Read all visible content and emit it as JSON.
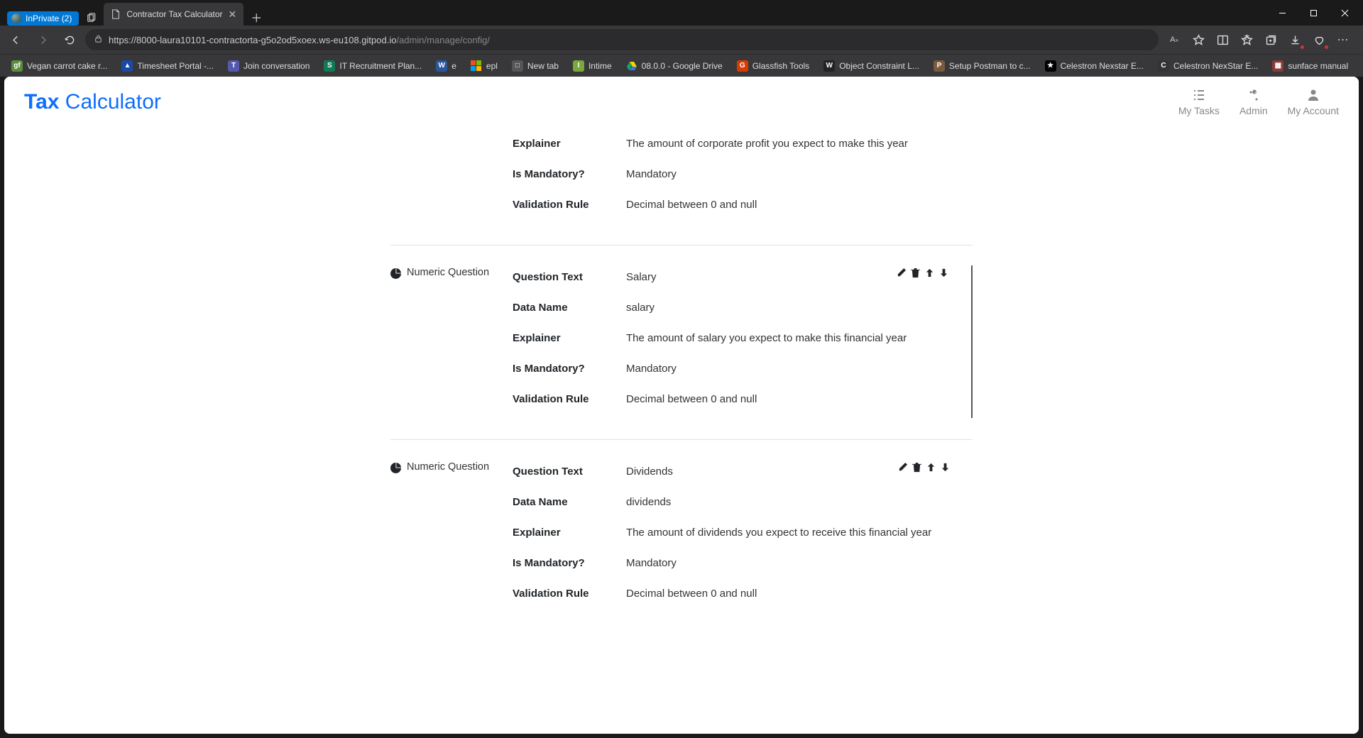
{
  "browser": {
    "inprivate_label": "InPrivate (2)",
    "tab_title": "Contractor Tax Calculator",
    "url_host": "https://8000-laura10101-contractorta-g5o2od5xoex.ws-eu108.gitpod.io",
    "url_path": "/admin/manage/config/",
    "bookmarks": [
      {
        "label": "Vegan carrot cake r...",
        "color": "#5a8f3c",
        "glyph": "gf"
      },
      {
        "label": "Timesheet Portal -...",
        "color": "#1a4aa8",
        "glyph": "▲"
      },
      {
        "label": "Join conversation",
        "color": "#5558af",
        "glyph": "T"
      },
      {
        "label": "IT Recruitment Plan...",
        "color": "#0f7a54",
        "glyph": "S"
      },
      {
        "label": "e",
        "color": "#2b579a",
        "glyph": "W"
      },
      {
        "label": "epl",
        "color": "",
        "glyph": "⊞",
        "ms": true
      },
      {
        "label": "New tab",
        "color": "#555",
        "glyph": "□"
      },
      {
        "label": "Intime",
        "color": "#7aa83a",
        "glyph": "I"
      },
      {
        "label": "08.0.0 - Google Drive",
        "color": "",
        "glyph": "▲",
        "drive": true
      },
      {
        "label": "Glassfish Tools",
        "color": "#d83b01",
        "glyph": "G"
      },
      {
        "label": "Object Constraint L...",
        "color": "#222",
        "glyph": "W"
      },
      {
        "label": "Setup Postman to c...",
        "color": "#7a5a3a",
        "glyph": "P"
      },
      {
        "label": "Celestron Nexstar E...",
        "color": "#000",
        "glyph": "★"
      },
      {
        "label": "Celestron NexStar E...",
        "color": "#333",
        "glyph": "C"
      },
      {
        "label": "sunface manual",
        "color": "#8a3a3a",
        "glyph": "▦"
      }
    ]
  },
  "app": {
    "brand_bold": "Tax",
    "brand_light": " Calculator",
    "nav": [
      {
        "label": "My Tasks"
      },
      {
        "label": "Admin"
      },
      {
        "label": "My Account"
      }
    ]
  },
  "field_labels": {
    "question_text": "Question Text",
    "data_name": "Data Name",
    "explainer": "Explainer",
    "is_mandatory": "Is Mandatory?",
    "validation_rule": "Validation Rule"
  },
  "type_label": "Numeric Question",
  "questions": [
    {
      "explainer": "The amount of corporate profit you expect to make this year",
      "is_mandatory": "Mandatory",
      "validation_rule": "Decimal between 0 and null"
    },
    {
      "question_text": "Salary",
      "data_name": "salary",
      "explainer": "The amount of salary you expect to make this financial year",
      "is_mandatory": "Mandatory",
      "validation_rule": "Decimal between 0 and null"
    },
    {
      "question_text": "Dividends",
      "data_name": "dividends",
      "explainer": "The amount of dividends you expect to receive this financial year",
      "is_mandatory": "Mandatory",
      "validation_rule": "Decimal between 0 and null"
    }
  ]
}
